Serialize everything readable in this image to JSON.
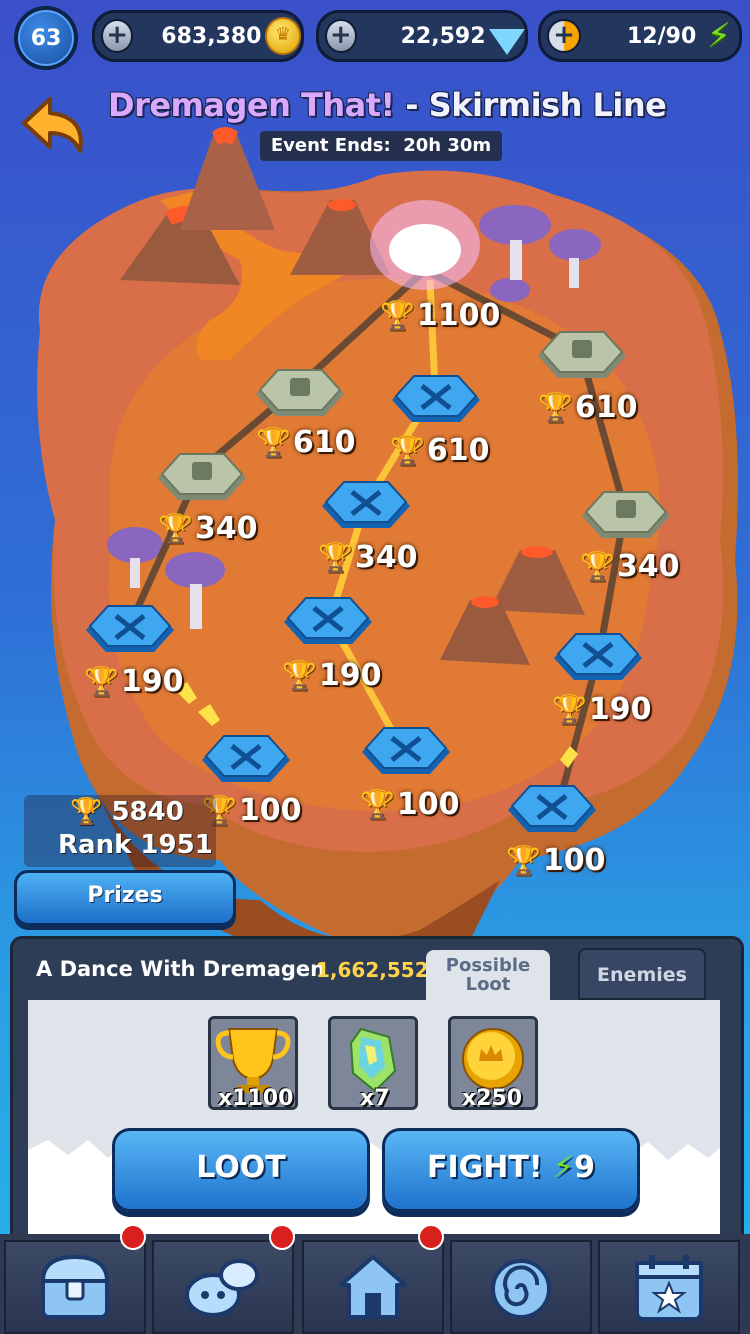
{
  "top_bar": {
    "level": "63",
    "coins": "683,380",
    "gems": "22,592",
    "energy": "12/90"
  },
  "header": {
    "title_part1": "Dremagen That!",
    "title_sep": " - ",
    "title_part2": "Skirmish Line",
    "event_ends": "Event Ends:  20h 30m"
  },
  "map_nodes": [
    {
      "score": "1100"
    },
    {
      "score": "610"
    },
    {
      "score": "610"
    },
    {
      "score": "610"
    },
    {
      "score": "340"
    },
    {
      "score": "340"
    },
    {
      "score": "340"
    },
    {
      "score": "190"
    },
    {
      "score": "190"
    },
    {
      "score": "190"
    },
    {
      "score": "100"
    },
    {
      "score": "100"
    },
    {
      "score": "100"
    }
  ],
  "ranking": {
    "trophies": "5840",
    "rank": "Rank 1951",
    "prizes_label": "Prizes"
  },
  "panel": {
    "title": "A Dance With Dremagen",
    "score": "1,662,552",
    "tab_loot": "Possible Loot",
    "tab_enemies": "Enemies",
    "loot": [
      {
        "icon": "trophy-icon",
        "qty": "x1100"
      },
      {
        "icon": "crystal-icon",
        "qty": "x7"
      },
      {
        "icon": "coin-icon",
        "qty": "x250"
      }
    ],
    "loot_button": "LOOT",
    "fight_button": "FIGHT!",
    "fight_cost": "9"
  },
  "bottom_nav": [
    {
      "icon": "chest-icon"
    },
    {
      "icon": "heroes-icon"
    },
    {
      "icon": "home-icon"
    },
    {
      "icon": "portal-icon"
    },
    {
      "icon": "calendar-icon"
    }
  ],
  "colors": {
    "trophy": "#ffc41a",
    "energy": "#77e01f",
    "button": "#2f8fe0"
  }
}
